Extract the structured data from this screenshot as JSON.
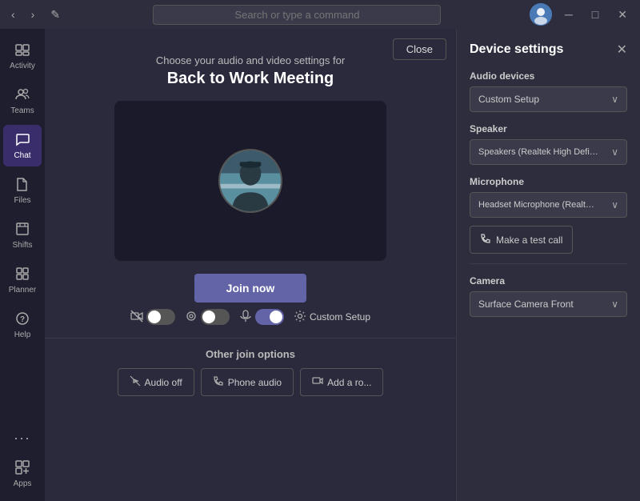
{
  "titlebar": {
    "search_placeholder": "Search or type a command",
    "back_label": "‹",
    "forward_label": "›",
    "edit_label": "✎",
    "minimize_label": "─",
    "maximize_label": "□",
    "close_label": "✕"
  },
  "sidebar": {
    "items": [
      {
        "id": "activity",
        "label": "Activity",
        "icon": "⊞",
        "active": false
      },
      {
        "id": "teams",
        "label": "Teams",
        "icon": "⊞",
        "active": false
      },
      {
        "id": "chat",
        "label": "Chat",
        "icon": "💬",
        "active": true
      },
      {
        "id": "files",
        "label": "Files",
        "icon": "📁",
        "active": false
      },
      {
        "id": "shifts",
        "label": "Shifts",
        "icon": "⊟",
        "active": false
      },
      {
        "id": "planner",
        "label": "Planner",
        "icon": "⊡",
        "active": false
      },
      {
        "id": "help",
        "label": "Help",
        "icon": "?",
        "active": false
      }
    ],
    "more_label": "...",
    "apps_label": "Apps",
    "apps_icon": "⊞"
  },
  "meeting": {
    "close_label": "Close",
    "subtitle": "Choose your audio and video settings for",
    "title": "Back to Work Meeting",
    "join_label": "Join now",
    "controls": {
      "custom_setup_label": "Custom Setup"
    }
  },
  "other_join": {
    "title": "Other join options",
    "options": [
      {
        "label": "Audio off",
        "icon": "🔇"
      },
      {
        "label": "Phone audio",
        "icon": "📞"
      },
      {
        "label": "Add a ro...",
        "icon": "📺"
      }
    ]
  },
  "device_settings": {
    "title": "Device settings",
    "close_label": "✕",
    "sections": {
      "audio_devices_label": "Audio devices",
      "audio_devices_value": "Custom Setup",
      "speaker_label": "Speaker",
      "speaker_value": "Speakers (Realtek High Definition Au...",
      "microphone_label": "Microphone",
      "microphone_value": "Headset Microphone (Realtek High D...",
      "make_test_call_label": "Make a test call",
      "camera_label": "Camera",
      "camera_value": "Surface Camera Front"
    }
  }
}
